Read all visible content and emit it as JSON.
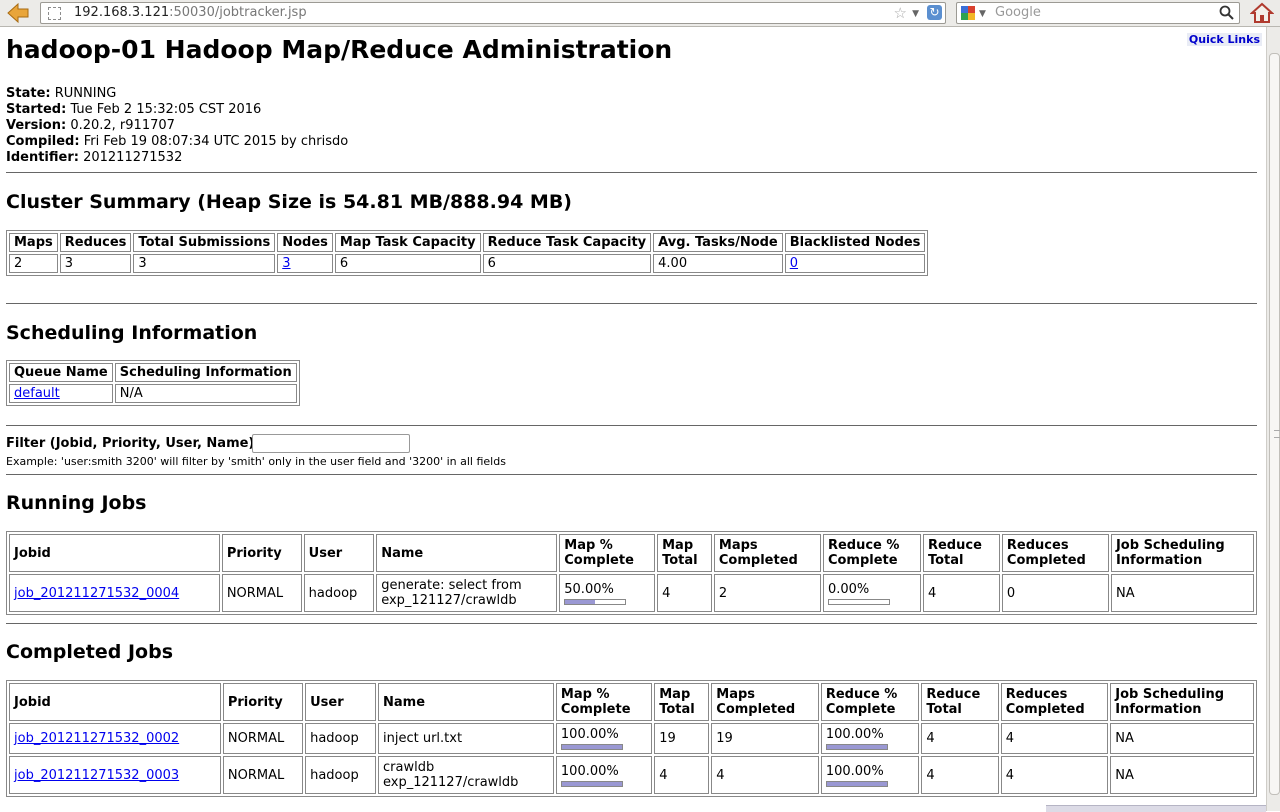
{
  "browser": {
    "url_host": "192.168.3.121",
    "url_path": ":50030/jobtracker.jsp",
    "search_placeholder": "Google"
  },
  "page": {
    "quick_links": "Quick Links",
    "title": "hadoop-01 Hadoop Map/Reduce Administration",
    "info": [
      {
        "label": "State:",
        "value": "RUNNING"
      },
      {
        "label": "Started:",
        "value": "Tue Feb 2 15:32:05 CST 2016"
      },
      {
        "label": "Version:",
        "value": "0.20.2, r911707"
      },
      {
        "label": "Compiled:",
        "value": "Fri Feb 19 08:07:34 UTC 2015 by chrisdo"
      },
      {
        "label": "Identifier:",
        "value": "201211271532"
      }
    ]
  },
  "cluster_summary": {
    "heading": "Cluster Summary (Heap Size is 54.81 MB/888.94 MB)",
    "headers": [
      "Maps",
      "Reduces",
      "Total Submissions",
      "Nodes",
      "Map Task Capacity",
      "Reduce Task Capacity",
      "Avg. Tasks/Node",
      "Blacklisted Nodes"
    ],
    "values": [
      "2",
      "3",
      "3",
      "3",
      "6",
      "6",
      "4.00",
      "0"
    ]
  },
  "scheduling": {
    "heading": "Scheduling Information",
    "headers": [
      "Queue Name",
      "Scheduling Information"
    ],
    "rows": [
      [
        "default",
        "N/A"
      ]
    ]
  },
  "filter": {
    "label": "Filter (Jobid, Priority, User, Name)",
    "value": "",
    "example": "Example: 'user:smith 3200' will filter by 'smith' only in the user field and '3200' in all fields"
  },
  "running_jobs": {
    "heading": "Running Jobs",
    "headers": {
      "jobid": "Jobid",
      "priority": "Priority",
      "user": "User",
      "name": "Name",
      "map_pct_1": "Map %",
      "map_pct_2": "Complete",
      "map_total_1": "Map",
      "map_total_2": "Total",
      "maps_completed_1": "Maps",
      "maps_completed_2": "Completed",
      "reduce_pct_1": "Reduce %",
      "reduce_pct_2": "Complete",
      "reduce_total_1": "Reduce",
      "reduce_total_2": "Total",
      "reduces_completed_1": "Reduces",
      "reduces_completed_2": "Completed",
      "sched_1": "Job Scheduling",
      "sched_2": "Information"
    },
    "rows": [
      {
        "jobid": "job_201211271532_0004",
        "priority": "NORMAL",
        "user": "hadoop",
        "name_1": "generate: select from",
        "name_2": "exp_121127/crawldb",
        "map_pct": "50.00%",
        "map_fraction": 0.5,
        "map_total": "4",
        "maps_completed": "2",
        "reduce_pct": "0.00%",
        "reduce_fraction": 0.0,
        "reduce_total": "4",
        "reduces_completed": "0",
        "sched": "NA"
      }
    ]
  },
  "completed_jobs": {
    "heading": "Completed Jobs",
    "rows": [
      {
        "jobid": "job_201211271532_0002",
        "priority": "NORMAL",
        "user": "hadoop",
        "name_1": "inject url.txt",
        "name_2": "",
        "map_pct": "100.00%",
        "map_fraction": 1.0,
        "map_total": "19",
        "maps_completed": "19",
        "reduce_pct": "100.00%",
        "reduce_fraction": 1.0,
        "reduce_total": "4",
        "reduces_completed": "4",
        "sched": "NA"
      },
      {
        "jobid": "job_201211271532_0003",
        "priority": "NORMAL",
        "user": "hadoop",
        "name_1": "crawldb",
        "name_2": "exp_121127/crawldb",
        "map_pct": "100.00%",
        "map_fraction": 1.0,
        "map_total": "4",
        "maps_completed": "4",
        "reduce_pct": "100.00%",
        "reduce_fraction": 1.0,
        "reduce_total": "4",
        "reduces_completed": "4",
        "sched": "NA"
      }
    ]
  }
}
